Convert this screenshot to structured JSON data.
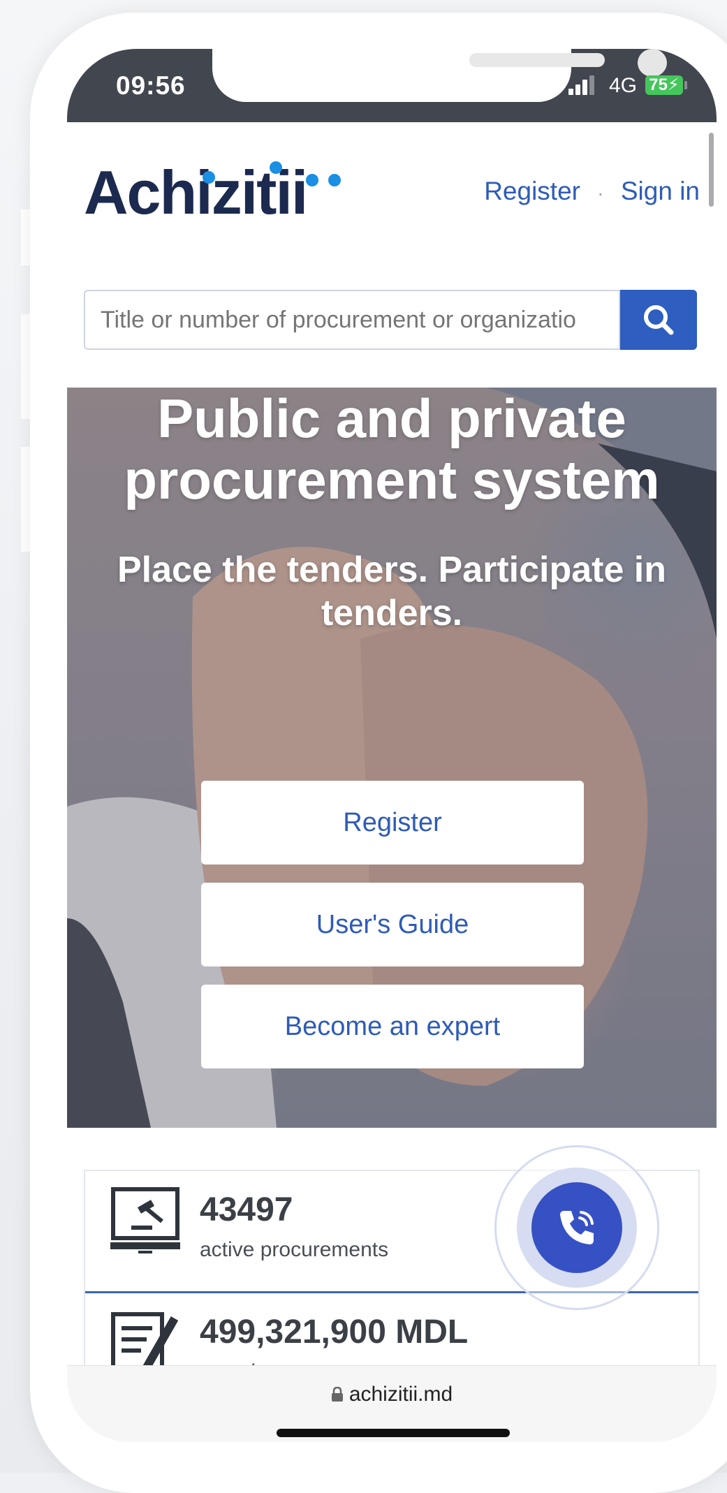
{
  "status_bar": {
    "time": "09:56",
    "network": "4G",
    "battery": "75"
  },
  "header": {
    "logo": "Achizitii",
    "nav_register": "Register",
    "nav_separator": "·",
    "nav_signin": "Sign in"
  },
  "search": {
    "placeholder": "Title or number of procurement or organizatio"
  },
  "hero": {
    "title_line1": "Public and private",
    "title_line2": "procurement system",
    "subtitle": "Place the tenders. Participate in tenders.",
    "btn_register": "Register",
    "btn_guide": "User's Guide",
    "btn_expert": "Become an expert"
  },
  "stats": [
    {
      "value": "43497",
      "label": "active procurements"
    },
    {
      "value": "499,321,900 MDL",
      "label": "saved"
    }
  ],
  "browser": {
    "url": "achizitii.md"
  },
  "colors": {
    "brand_blue": "#2d5ec0",
    "logo_navy": "#1b2a4e",
    "call_blue": "#3651c4"
  }
}
